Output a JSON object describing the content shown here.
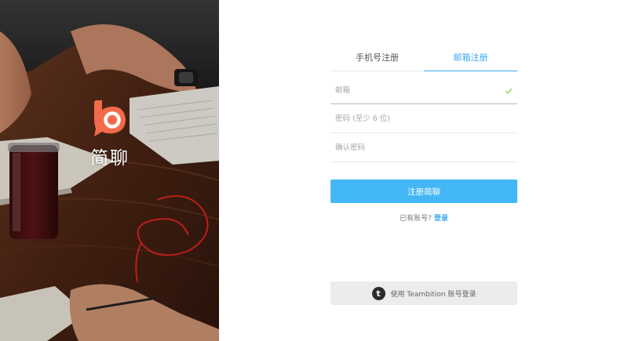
{
  "brand": {
    "name": "简聊",
    "logo_icon": "speech-bubble-b-logo",
    "logo_color": "#f26b4b"
  },
  "tabs": [
    {
      "label": "手机号注册",
      "active": false
    },
    {
      "label": "邮箱注册",
      "active": true
    }
  ],
  "form": {
    "email": {
      "placeholder": "邮箱",
      "value": "",
      "valid": true
    },
    "password": {
      "placeholder": "密码 (至少 6 位)",
      "value": ""
    },
    "confirm_password": {
      "placeholder": "确认密码",
      "value": ""
    },
    "submit_label": "注册简聊"
  },
  "login_hint": {
    "text": "已有账号?",
    "link_label": "登录"
  },
  "teambition": {
    "icon_letter": "t",
    "label": "使用 Teambition 账号登录"
  },
  "colors": {
    "accent": "#3da8f5",
    "button": "#43b7f5",
    "valid_check": "#8fd46a"
  }
}
